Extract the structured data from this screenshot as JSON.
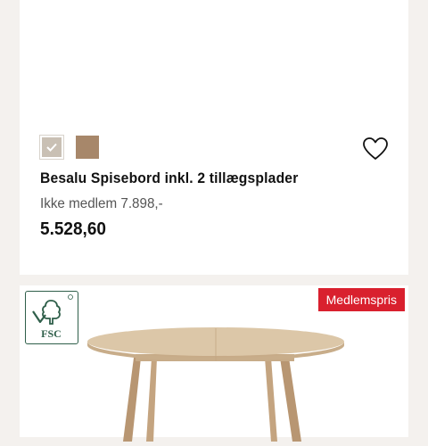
{
  "product": {
    "title": "Besalu Spisebord inkl. 2 tillægsplader",
    "non_member_price": "Ikke medlem 7.898,-",
    "member_price": "5.528,60",
    "swatches": [
      {
        "color": "#c9c0b4",
        "selected": true
      },
      {
        "color": "#a7876a",
        "selected": false
      }
    ]
  },
  "next_product": {
    "badge": "Medlemspris",
    "certification": "FSC"
  },
  "colors": {
    "badge": "#d9202e",
    "fsc_green": "#2f5f4a",
    "wood_top": "#dcc7a8",
    "wood_legs": "#b89672"
  }
}
